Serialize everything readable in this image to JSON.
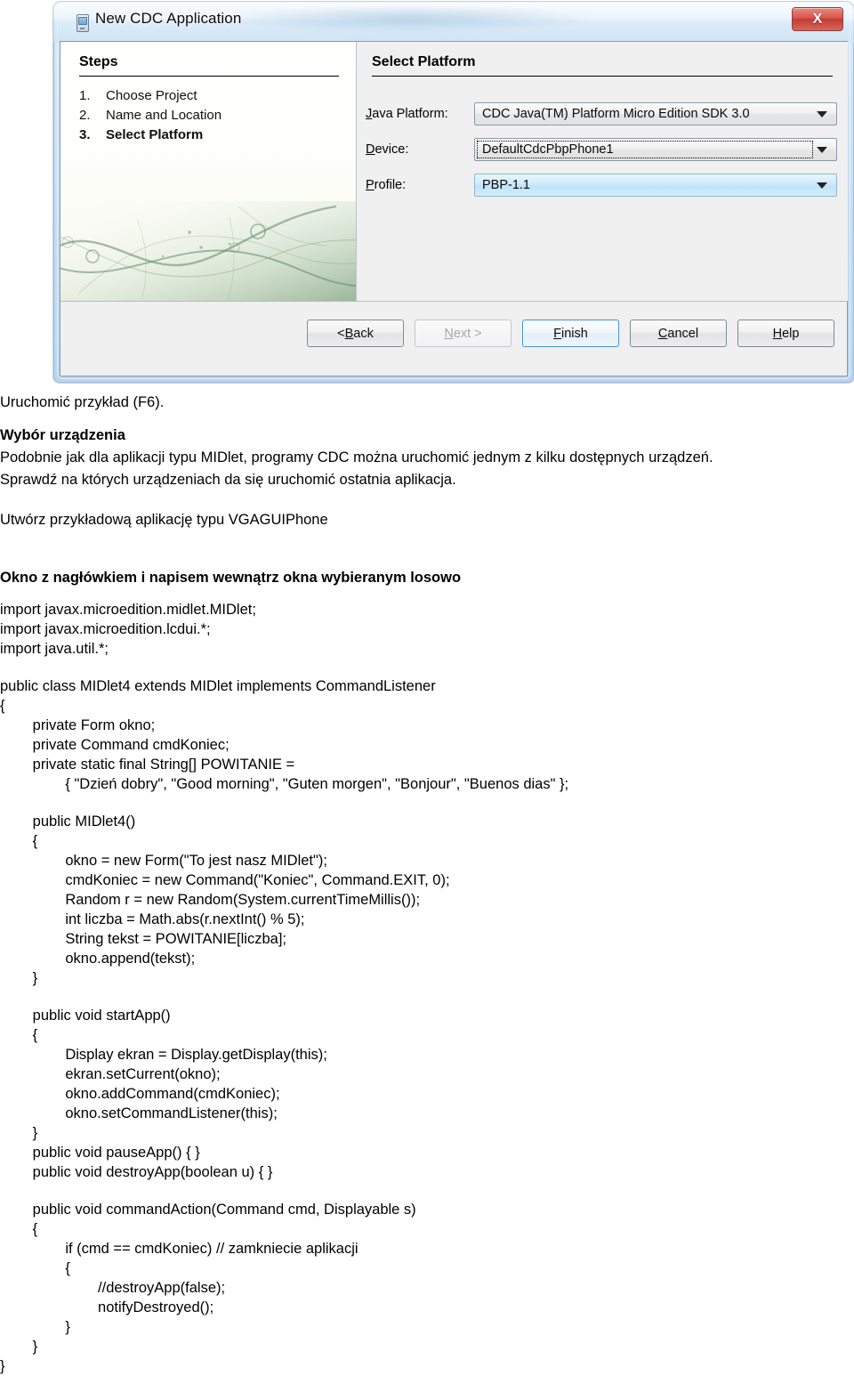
{
  "dialog": {
    "title": "New CDC Application",
    "title_icon": "device-phone-icon",
    "close_label": "X",
    "steps": {
      "heading": "Steps",
      "items": [
        {
          "num": "1.",
          "label": "Choose Project",
          "current": false
        },
        {
          "num": "2.",
          "label": "Name and Location",
          "current": false
        },
        {
          "num": "3.",
          "label": "Select Platform",
          "current": true
        }
      ]
    },
    "panel": {
      "heading": "Select Platform",
      "fields": [
        {
          "label": "Java Platform:",
          "mnemonic": "J",
          "value": "CDC Java(TM) Platform Micro Edition SDK 3.0",
          "state": "normal"
        },
        {
          "label": "Device:",
          "mnemonic": "D",
          "value": "DefaultCdcPbpPhone1",
          "state": "focused"
        },
        {
          "label": "Profile:",
          "mnemonic": "P",
          "value": "PBP-1.1",
          "state": "highlight"
        }
      ]
    },
    "buttons": [
      {
        "label": "< Back",
        "mnemonic": "B",
        "state": "normal"
      },
      {
        "label": "Next >",
        "mnemonic": "N",
        "state": "disabled"
      },
      {
        "label": "Finish",
        "mnemonic": "F",
        "state": "default"
      },
      {
        "label": "Cancel",
        "mnemonic": "C",
        "state": "normal"
      },
      {
        "label": "Help",
        "mnemonic": "H",
        "state": "normal"
      }
    ],
    "colors": {
      "frame": "#c3dbf1",
      "close_button": "#c23b33",
      "default_button_border": "#3c93d4",
      "highlight_combo": "#cfeafb",
      "left_pane_art": "#7ca07c"
    }
  },
  "document": {
    "line_f6": "Uruchomić przykład (F6).",
    "heading_device": "Wybór urządzenia",
    "para_device_1": "Podobnie jak dla aplikacji typu MIDlet, programy CDC można uruchomić jednym z kilku dostępnych urządzeń.",
    "para_device_2": "Sprawdź na których urządzeniach da się uruchomić ostatnia aplikacja.",
    "line_create": "Utwórz przykładową aplikację typu VGAGUIPhone",
    "heading_window": "Okno z nagłówkiem i napisem wewnątrz okna wybieranym losowo",
    "code": {
      "imports": "import javax.microedition.midlet.MIDlet;\nimport javax.microedition.lcdui.*;\nimport java.util.*;",
      "class_decl": "public class MIDlet4 extends MIDlet implements CommandListener\n{",
      "fields": "        private Form okno;\n        private Command cmdKoniec;\n        private static final String[] POWITANIE =\n                { \"Dzień dobry\", \"Good morning\", \"Guten morgen\", \"Bonjour\", \"Buenos dias\" };",
      "constructor": "        public MIDlet4()\n        {\n                okno = new Form(\"To jest nasz MIDlet\");\n                cmdKoniec = new Command(\"Koniec\", Command.EXIT, 0);\n                Random r = new Random(System.currentTimeMillis());\n                int liczba = Math.abs(r.nextInt() % 5);\n                String tekst = POWITANIE[liczba];\n                okno.append(tekst);\n        }",
      "start_app": "        public void startApp()\n        {\n                Display ekran = Display.getDisplay(this);\n                ekran.setCurrent(okno);\n                okno.addCommand(cmdKoniec);\n                okno.setCommandListener(this);\n        }\n        public void pauseApp() { }\n        public void destroyApp(boolean u) { }",
      "command_action": "        public void commandAction(Command cmd, Displayable s)\n        {\n                if (cmd == cmdKoniec) // zamkniecie aplikacji\n                {\n                        //destroyApp(false);\n                        notifyDestroyed();\n                }\n        }\n}"
    }
  }
}
